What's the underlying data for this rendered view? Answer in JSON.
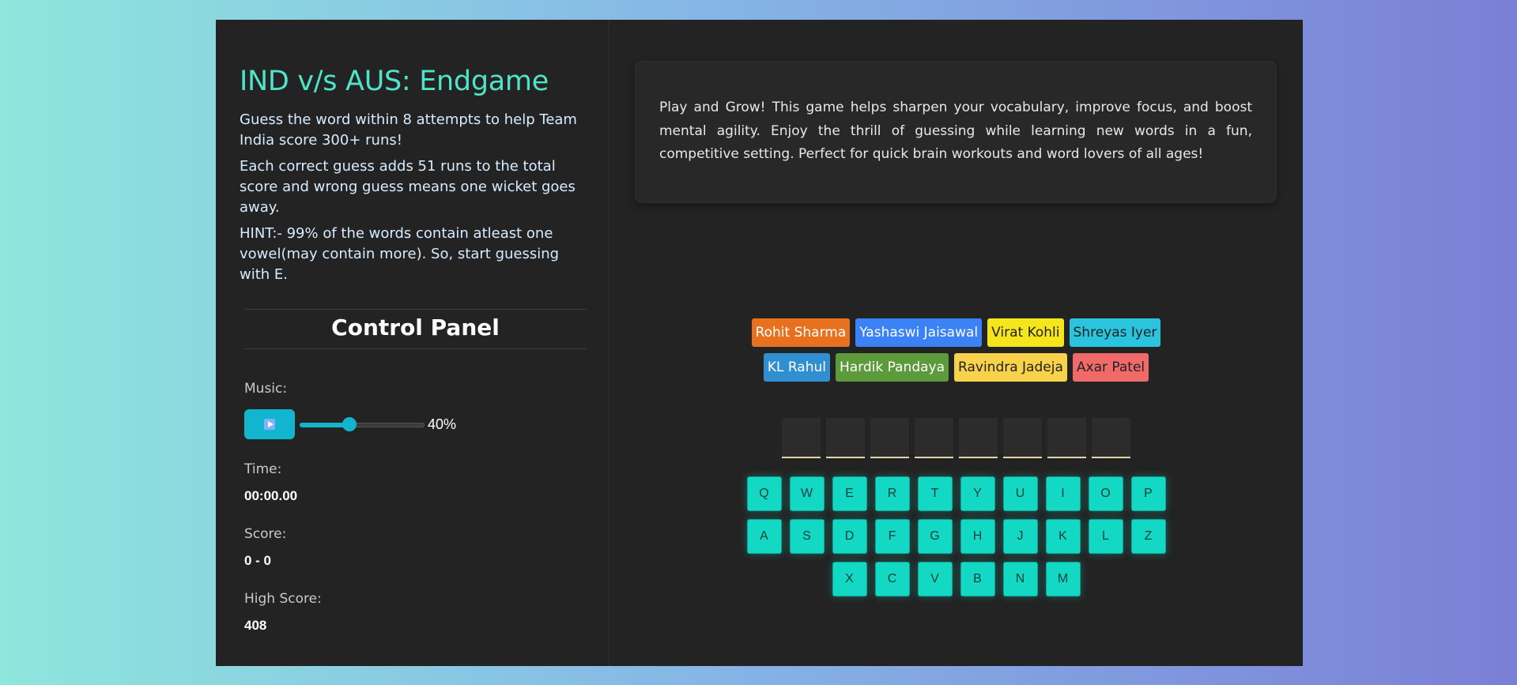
{
  "game": {
    "title": "IND v/s AUS: Endgame",
    "intro": "Guess the word within 8 attempts to help Team India score 300+ runs!",
    "rules": "Each correct guess adds 51 runs to the total score and wrong guess means one wicket goes away.",
    "hint": "HINT:- 99% of the words contain atleast one vowel(may contain more). So, start guessing with E."
  },
  "control_panel": {
    "title": "Control Panel",
    "music_label": "Music:",
    "play_icon": "play-icon",
    "volume_percent": 40,
    "volume_text": "40%",
    "time_label": "Time:",
    "time_value": "00:00.00",
    "score_label": "Score:",
    "score_value": "0 - 0",
    "high_score_label": "High Score:",
    "high_score_value": "408"
  },
  "about": {
    "text": "Play and Grow! This game helps sharpen your vocabulary, improve focus, and boost mental agility. Enjoy the thrill of guessing while learning new words in a fun, competitive setting. Perfect for quick brain workouts and word lovers of all ages!"
  },
  "players": [
    [
      {
        "name": "Rohit Sharma",
        "bg": "#e8711f",
        "fg": "#ffffff"
      },
      {
        "name": "Yashaswi Jaisawal",
        "bg": "#3b82f6",
        "fg": "#ffffff"
      },
      {
        "name": "Virat Kohli",
        "bg": "#f5e61c",
        "fg": "#222222"
      },
      {
        "name": "Shreyas Iyer",
        "bg": "#2bc4de",
        "fg": "#222222"
      }
    ],
    [
      {
        "name": "KL Rahul",
        "bg": "#2f8fd0",
        "fg": "#ffffff"
      },
      {
        "name": "Hardik Pandaya",
        "bg": "#5c9a3c",
        "fg": "#ffffff"
      },
      {
        "name": "Ravindra Jadeja",
        "bg": "#f7d24a",
        "fg": "#222222"
      },
      {
        "name": "Axar Patel",
        "bg": "#f06a6a",
        "fg": "#222222"
      }
    ]
  ],
  "word_slots": 8,
  "keyboard": [
    [
      "Q",
      "W",
      "E",
      "R",
      "T",
      "Y",
      "U",
      "I",
      "O",
      "P"
    ],
    [
      "A",
      "S",
      "D",
      "F",
      "G",
      "H",
      "J",
      "K",
      "L",
      "Z"
    ],
    [
      "X",
      "C",
      "V",
      "B",
      "N",
      "M"
    ]
  ]
}
